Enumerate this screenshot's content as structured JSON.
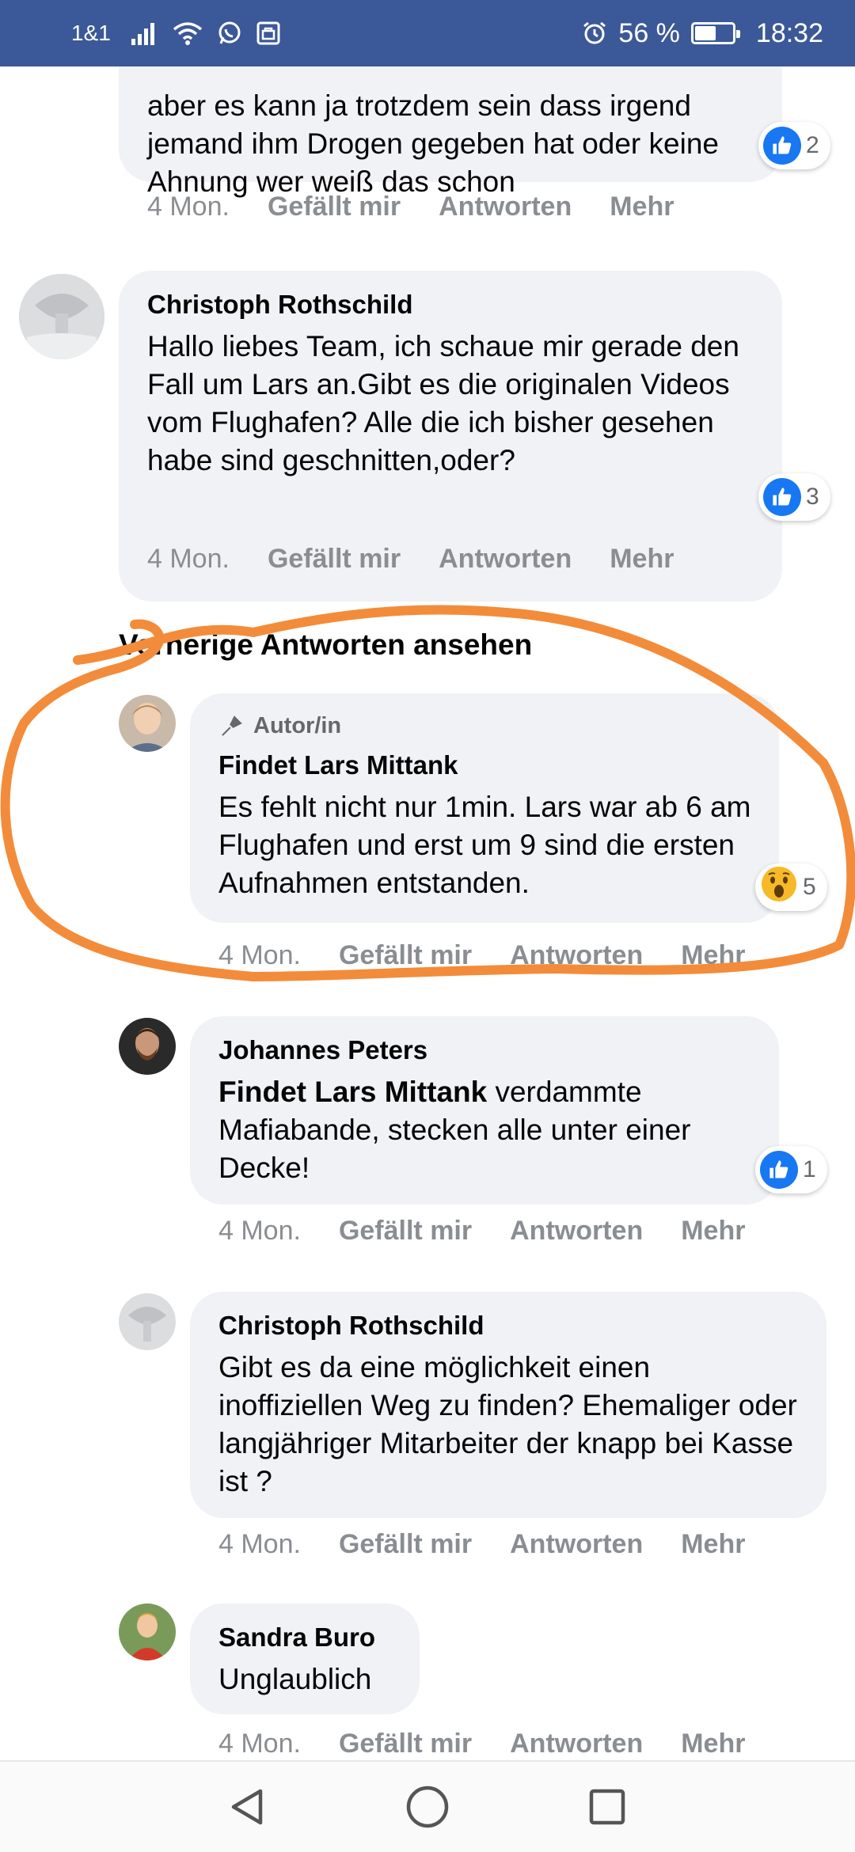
{
  "status": {
    "carrier": "1&1",
    "battery": "56 %",
    "time": "18:32",
    "battery_level": 0.56
  },
  "comments": [
    {
      "id": "c0",
      "text": "aber es kann ja trotzdem sein dass irgend jemand ihm Drogen gegeben hat oder keine Ahnung wer weiß das schon",
      "time": "4 Mon.",
      "reaction": {
        "type": "like",
        "count": "2"
      }
    },
    {
      "id": "c1",
      "name": "Christoph Rothschild",
      "text": "Hallo liebes Team, ich schaue mir gerade den Fall um Lars an.Gibt es die originalen Videos vom Flughafen? Alle die ich bisher gesehen habe sind geschnitten,oder?",
      "time": "4 Mon.",
      "reaction": {
        "type": "like",
        "count": "3"
      }
    },
    {
      "id": "r1",
      "author_badge": "Autor/in",
      "name": "Findet Lars Mittank",
      "text": "Es fehlt nicht nur 1min. Lars war ab 6 am Flughafen und erst um 9 sind die ersten Aufnahmen entstanden.",
      "time": "4 Mon.",
      "reaction": {
        "type": "wow",
        "count": "5"
      }
    },
    {
      "id": "r2",
      "name": "Johannes Peters",
      "mention": "Findet Lars Mittank",
      "text": " verdammte Mafiabande, stecken alle unter einer Decke!",
      "time": "4 Mon.",
      "reaction": {
        "type": "like",
        "count": "1"
      }
    },
    {
      "id": "r3",
      "name": "Christoph Rothschild",
      "text": "Gibt es da eine möglichkeit einen inoffiziellen Weg zu finden? Ehemaliger oder langjähriger Mitarbeiter der knapp bei Kasse ist ?",
      "time": "4 Mon."
    },
    {
      "id": "r4",
      "name": "Sandra Buro",
      "text": "Unglaublich",
      "time": "4 Mon."
    }
  ],
  "actions": {
    "like": "Gefällt mir",
    "reply": "Antworten",
    "more": "Mehr"
  },
  "previous_replies": "Vorherige Antworten ansehen",
  "colors": {
    "header": "#3b5998",
    "bubble": "#f0f2f5",
    "like": "#1877f2",
    "scribble": "#f28c3b",
    "muted": "#8a8d91"
  },
  "icons": {
    "signal": "signal-icon",
    "wifi": "wifi-icon",
    "whatsapp": "whatsapp-icon",
    "alarm": "alarm-icon",
    "back": "back-triangle-icon",
    "home": "home-circle-icon",
    "recents": "recents-square-icon"
  }
}
